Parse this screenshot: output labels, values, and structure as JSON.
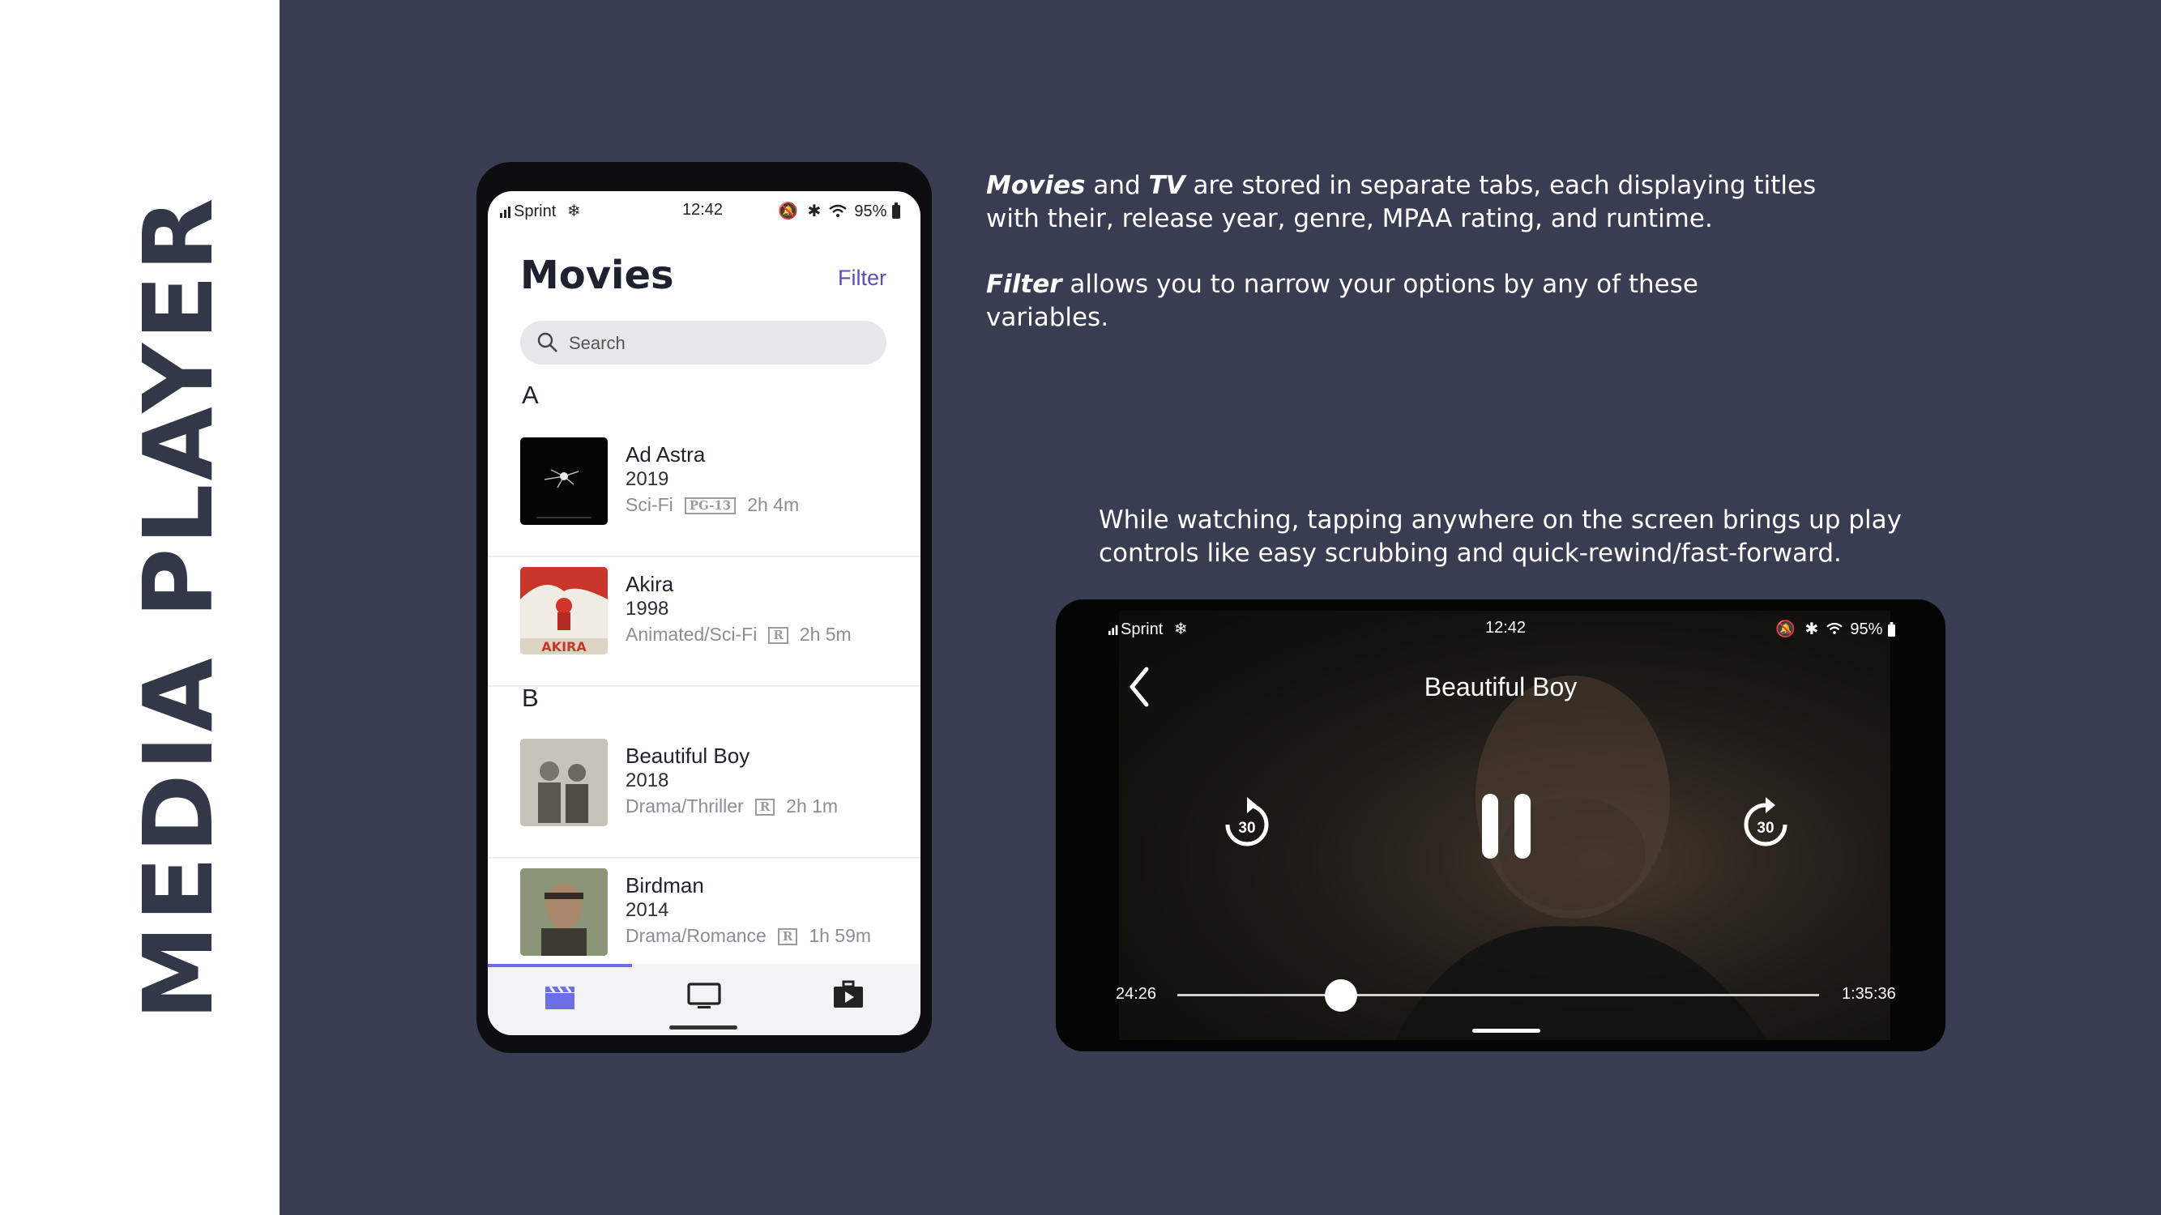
{
  "sidebar": {
    "title": "MEDIA PLAYER"
  },
  "notes": {
    "note1": {
      "em1": "Movies",
      "t1": " and ",
      "em2": "TV",
      "t2": " are stored in separate tabs, each displaying titles",
      "t3": "with their, release year, genre, MPAA rating, and runtime."
    },
    "note2": {
      "em": "Filter",
      "t1": " allows you to narrow your options by any of these",
      "t2": "variables."
    },
    "note3": {
      "l1": "While watching, tapping anywhere on the screen brings up play",
      "l2": "controls like easy scrubbing and quick-rewind/fast-forward."
    }
  },
  "phone": {
    "status": {
      "carrier": "Sprint",
      "time": "12:42",
      "battery": "95%"
    },
    "title": "Movies",
    "filter_label": "Filter",
    "search_placeholder": "Search",
    "sections": [
      {
        "letter": "A",
        "movies": [
          {
            "title": "Ad Astra",
            "year": "2019",
            "genre": "Sci-Fi",
            "rating": "PG-13",
            "runtime": "2h 4m"
          },
          {
            "title": "Akira",
            "year": "1998",
            "genre": "Animated/Sci-Fi",
            "rating": "R",
            "runtime": "2h 5m"
          }
        ]
      },
      {
        "letter": "B",
        "movies": [
          {
            "title": "Beautiful Boy",
            "year": "2018",
            "genre": "Drama/Thriller",
            "rating": "R",
            "runtime": "2h 1m"
          },
          {
            "title": "Birdman",
            "year": "2014",
            "genre": "Drama/Romance",
            "rating": "R",
            "runtime": "1h 59m"
          }
        ]
      }
    ],
    "tabs": [
      {
        "name": "movies",
        "icon": "clapperboard-icon",
        "active": true
      },
      {
        "name": "tv",
        "icon": "tv-icon",
        "active": false
      },
      {
        "name": "library",
        "icon": "play-case-icon",
        "active": false
      }
    ],
    "accent_color": "#6c6ee6"
  },
  "player": {
    "status": {
      "carrier": "Sprint",
      "time": "12:42",
      "battery": "95%"
    },
    "title": "Beautiful Boy",
    "rewind_seconds": "30",
    "forward_seconds": "30",
    "elapsed": "24:26",
    "total": "1:35:36",
    "progress": 0.255
  }
}
